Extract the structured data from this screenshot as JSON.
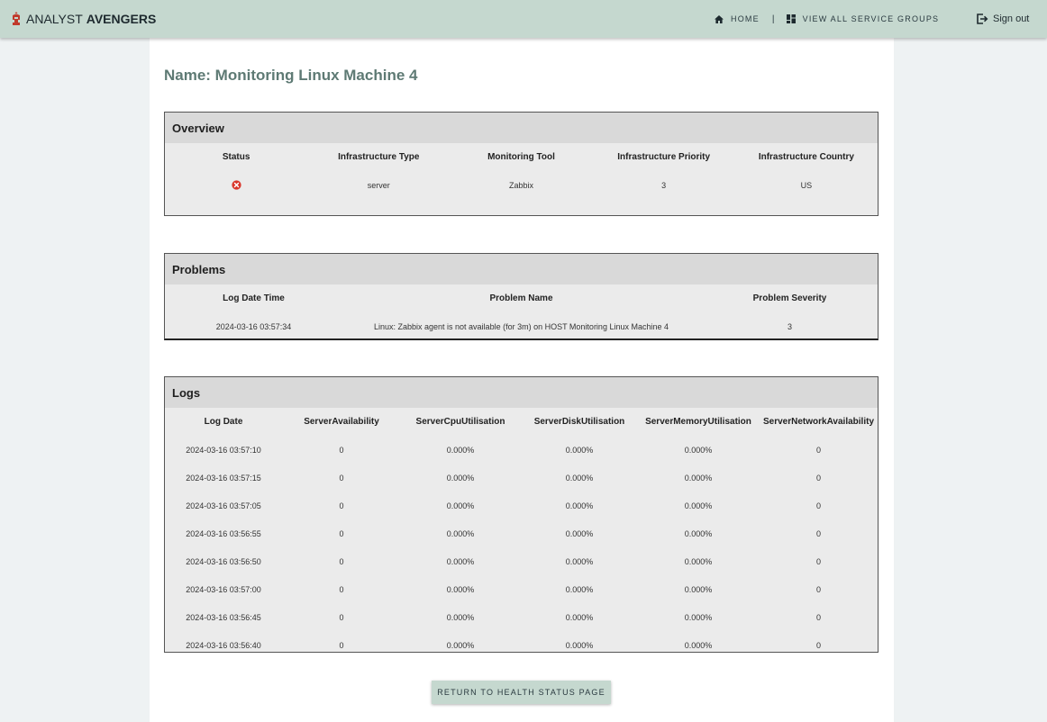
{
  "nav": {
    "brand_light": "ANALYST",
    "brand_bold": "AVENGERS",
    "home_label": "HOME",
    "separator": "|",
    "service_groups_label": "VIEW ALL SERVICE GROUPS",
    "signout_label": "Sign out"
  },
  "page_title": "Name: Monitoring Linux Machine 4",
  "overview": {
    "title": "Overview",
    "headers": [
      "Status",
      "Infrastructure Type",
      "Monitoring Tool",
      "Infrastructure Priority",
      "Infrastructure Country"
    ],
    "row": {
      "status_icon": "error-circle-icon",
      "status_color": "#d9362b",
      "type": "server",
      "tool": "Zabbix",
      "priority": "3",
      "country": "US"
    }
  },
  "problems": {
    "title": "Problems",
    "headers": [
      "Log Date Time",
      "Problem Name",
      "Problem Severity"
    ],
    "rows": [
      [
        "2024-03-16 03:57:34",
        "Linux: Zabbix agent is not available (for 3m) on HOST Monitoring Linux Machine 4",
        "3"
      ]
    ]
  },
  "logs": {
    "title": "Logs",
    "headers": [
      "Log Date",
      "ServerAvailability",
      "ServerCpuUtilisation",
      "ServerDiskUtilisation",
      "ServerMemoryUtilisation",
      "ServerNetworkAvailability"
    ],
    "rows": [
      [
        "2024-03-16 03:57:10",
        "0",
        "0.000%",
        "0.000%",
        "0.000%",
        "0"
      ],
      [
        "2024-03-16 03:57:15",
        "0",
        "0.000%",
        "0.000%",
        "0.000%",
        "0"
      ],
      [
        "2024-03-16 03:57:05",
        "0",
        "0.000%",
        "0.000%",
        "0.000%",
        "0"
      ],
      [
        "2024-03-16 03:56:55",
        "0",
        "0.000%",
        "0.000%",
        "0.000%",
        "0"
      ],
      [
        "2024-03-16 03:56:50",
        "0",
        "0.000%",
        "0.000%",
        "0.000%",
        "0"
      ],
      [
        "2024-03-16 03:57:00",
        "0",
        "0.000%",
        "0.000%",
        "0.000%",
        "0"
      ],
      [
        "2024-03-16 03:56:45",
        "0",
        "0.000%",
        "0.000%",
        "0.000%",
        "0"
      ],
      [
        "2024-03-16 03:56:40",
        "0",
        "0.000%",
        "0.000%",
        "0.000%",
        "0"
      ]
    ]
  },
  "return_button_label": "RETURN TO HEALTH STATUS PAGE",
  "colors": {
    "navbar": "#c5d8cf",
    "title_accent": "#5e7a74",
    "brand_icon": "#c0392b"
  }
}
